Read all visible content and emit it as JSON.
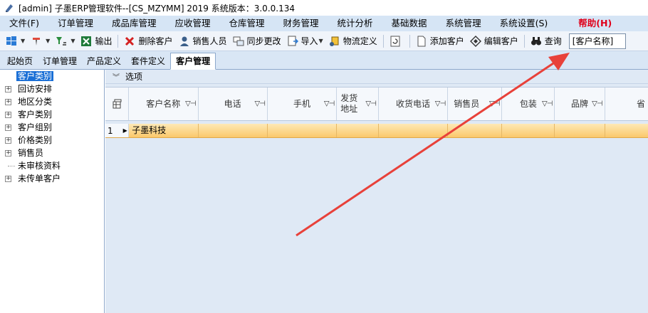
{
  "window": {
    "title": "[admin] 子墨ERP管理软件--[CS_MZYMM] 2019 系统版本：3.0.0.134"
  },
  "menu": {
    "items": [
      "文件(F)",
      "订单管理",
      "成品库管理",
      "应收管理",
      "仓库管理",
      "财务管理",
      "统计分析",
      "基础数据",
      "系统管理",
      "系统设置(S)"
    ],
    "help": "帮助(H)"
  },
  "toolbar": {
    "export": "输出",
    "delete_customer": "删除客户",
    "salesperson": "销售人员",
    "sync_changes": "同步更改",
    "import": "导入",
    "logistics": "物流定义",
    "add_customer": "添加客户",
    "edit_customer": "编辑客户",
    "query": "查询",
    "search_field": "[客户名称]"
  },
  "tabs": [
    "起始页",
    "订单管理",
    "产品定义",
    "套件定义",
    "客户管理"
  ],
  "tree": {
    "items": [
      {
        "label": "客户类别",
        "expander": false,
        "selected": true
      },
      {
        "label": "回访安排",
        "expander": true
      },
      {
        "label": "地区分类",
        "expander": true
      },
      {
        "label": "客户类别",
        "expander": true
      },
      {
        "label": "客户组别",
        "expander": true
      },
      {
        "label": "价格类别",
        "expander": true
      },
      {
        "label": "销售员",
        "expander": true
      },
      {
        "label": "未审核资料",
        "expander": false
      },
      {
        "label": "未传单客户",
        "expander": true
      }
    ]
  },
  "options": {
    "label": "选项"
  },
  "grid": {
    "columns": [
      "客户名称",
      "电话",
      "手机",
      "发货\n地址",
      "收货电话",
      "销售员",
      "包装",
      "品牌",
      "省"
    ],
    "rows": [
      {
        "index": "1",
        "cells": [
          "子墨科技",
          "",
          "",
          "",
          "",
          "",
          "",
          "",
          ""
        ]
      }
    ]
  },
  "colors": {
    "accent_arrow": "#e8413a",
    "selection": "#1a6fd6",
    "row_highlight": "#fbc86b",
    "help_text": "#e0001a"
  }
}
